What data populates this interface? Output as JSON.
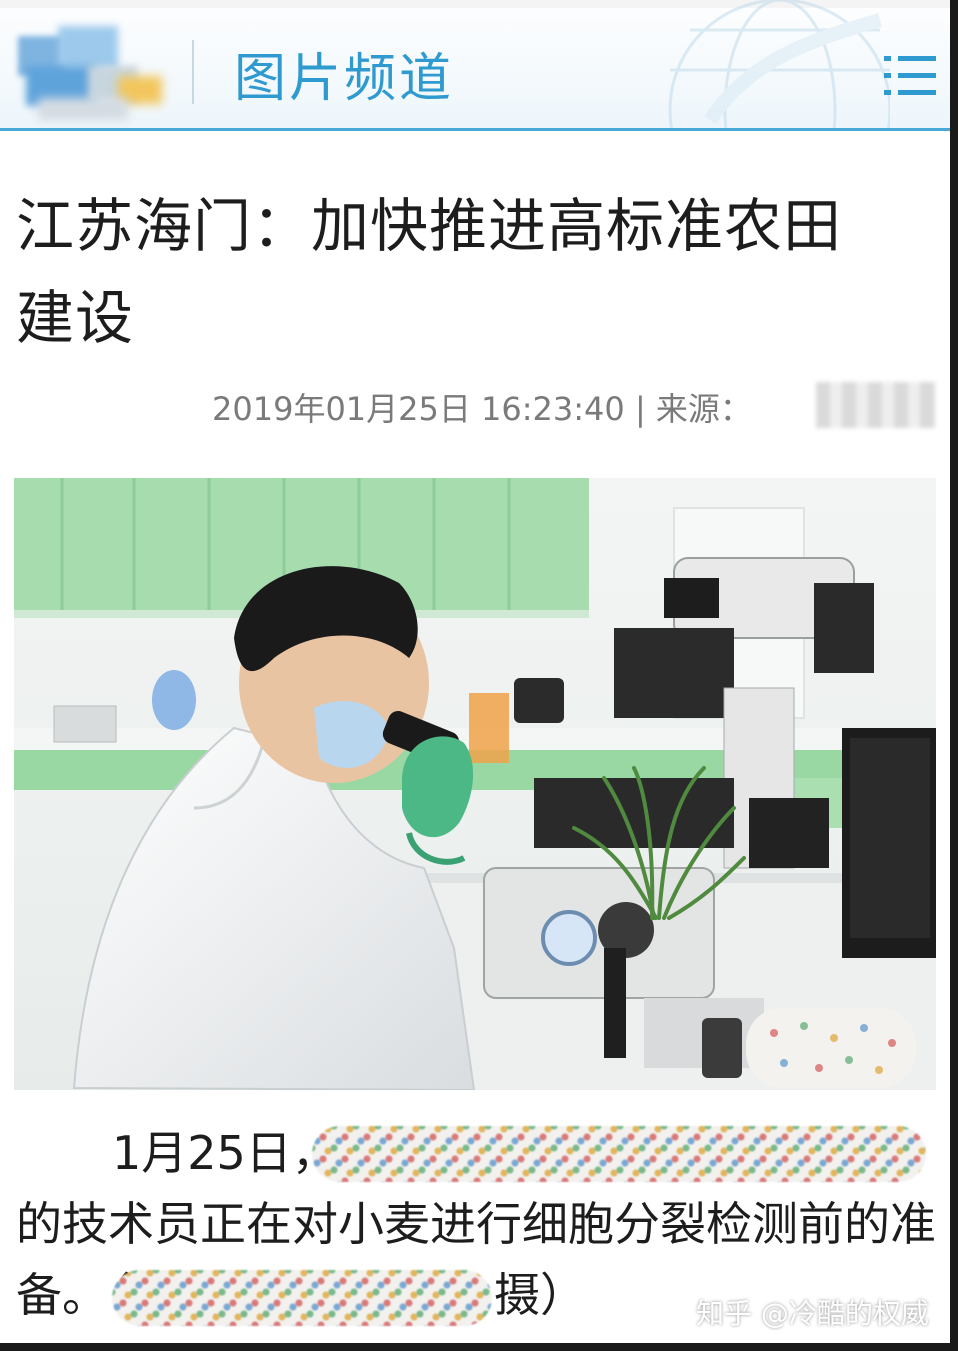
{
  "header": {
    "channel_title": "图片频道",
    "menu_icon": "hamburger-menu-icon",
    "accent": "#2e9ad0"
  },
  "article": {
    "title_line1": "江苏海门：加快推进高标准农田",
    "title_line2": "建设",
    "date": "2019年01月25日 16:23:40 | 来源：",
    "caption_line1_start": "1月25日，",
    "caption_line2": "的技术员正在对小麦进行细胞分裂检测前的准",
    "caption_line3_start": "备。（",
    "caption_line3_end": "摄）"
  },
  "watermark": "知乎 @冷酷的权威"
}
